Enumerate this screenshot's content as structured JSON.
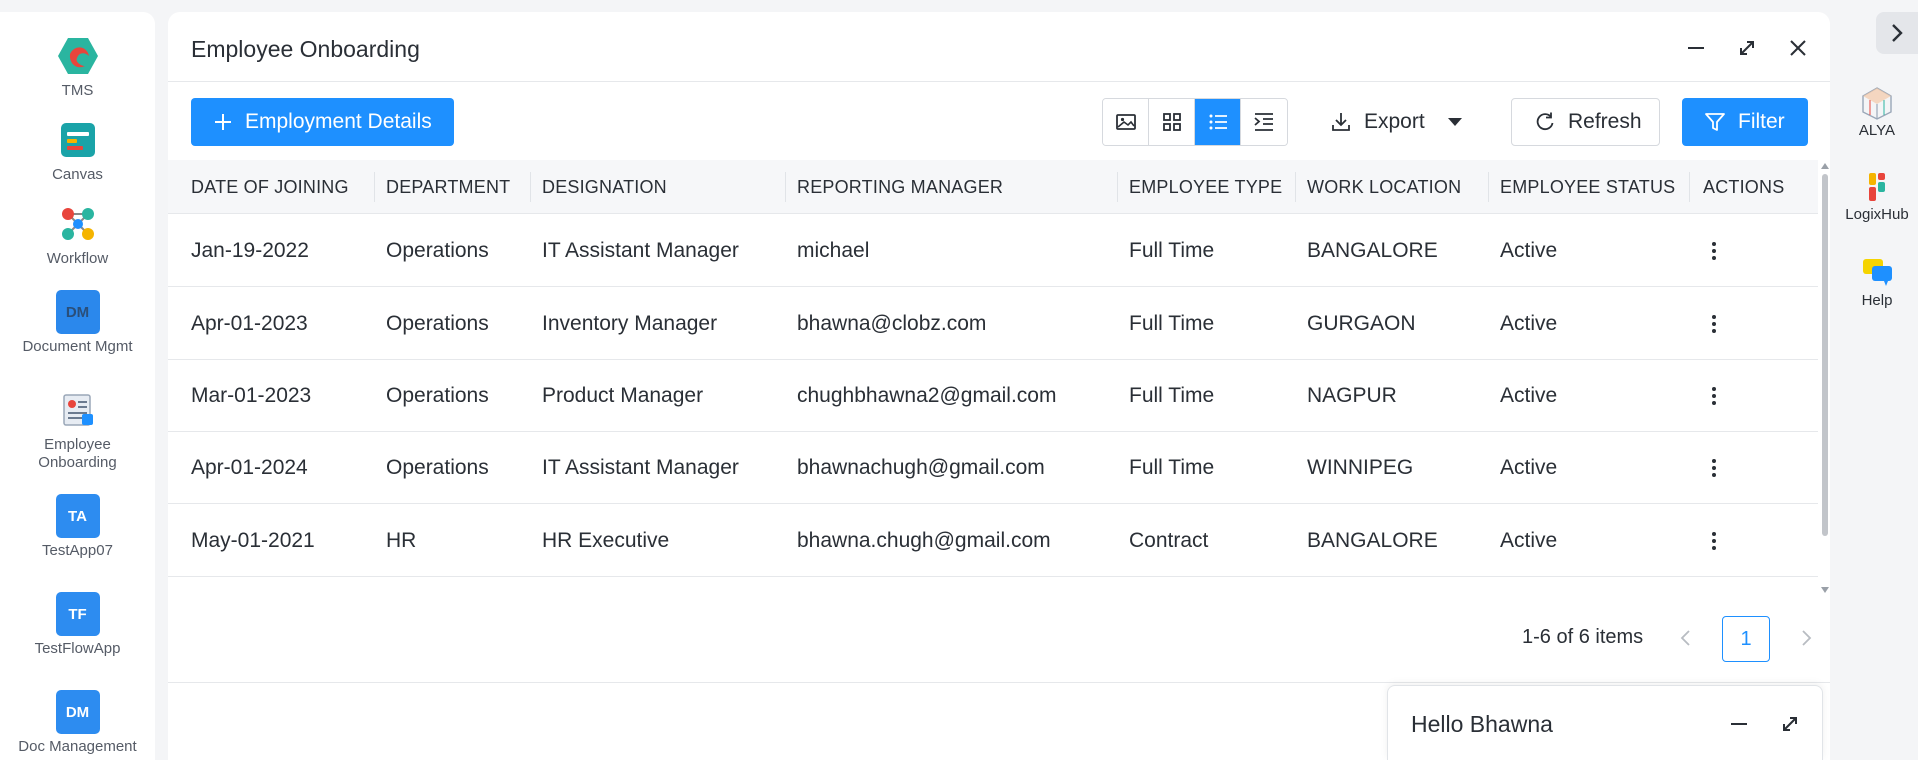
{
  "left_sidebar": {
    "apps": [
      {
        "label": "TMS",
        "icon": "tms-hexagon-icon"
      },
      {
        "label": "Canvas",
        "icon": "canvas-icon"
      },
      {
        "label": "Workflow",
        "icon": "workflow-icon"
      },
      {
        "label": "Document Mgmt",
        "icon": "document-mgmt-icon",
        "tile": "DM"
      },
      {
        "label": "Employee Onboarding",
        "icon": "employee-onboarding-icon"
      },
      {
        "label": "TestApp07",
        "icon": "testapp07-icon",
        "tile": "TA"
      },
      {
        "label": "TestFlowApp",
        "icon": "testflowapp-icon",
        "tile": "TF"
      },
      {
        "label": "Doc Management",
        "icon": "doc-management-icon",
        "tile": "DM"
      }
    ]
  },
  "window": {
    "title": "Employee Onboarding",
    "controls": [
      "minimize-icon",
      "expand-icon",
      "close-icon"
    ]
  },
  "toolbar": {
    "add_label": "Employment Details",
    "views": [
      "image-view-icon",
      "grid-view-icon",
      "list-view-icon",
      "indent-view-icon"
    ],
    "active_view": "list-view-icon",
    "export_label": "Export",
    "refresh_label": "Refresh",
    "filter_label": "Filter",
    "accent_color": "#1e90ff"
  },
  "table": {
    "columns": [
      "DATE OF JOINING",
      "DEPARTMENT",
      "DESIGNATION",
      "REPORTING MANAGER",
      "EMPLOYEE TYPE",
      "WORK LOCATION",
      "EMPLOYEE STATUS",
      "ACTIONS"
    ],
    "rows": [
      [
        "Jan-19-2022",
        "Operations",
        "IT Assistant Manager",
        "michael",
        "Full Time",
        "BANGALORE",
        "Active"
      ],
      [
        "Apr-01-2023",
        "Operations",
        "Inventory Manager",
        "bhawna@clobz.com",
        "Full Time",
        "GURGAON",
        "Active"
      ],
      [
        "Mar-01-2023",
        "Operations",
        "Product Manager",
        "chughbhawna2@gmail.com",
        "Full Time",
        "NAGPUR",
        "Active"
      ],
      [
        "Apr-01-2024",
        "Operations",
        "IT Assistant Manager",
        "bhawnachugh@gmail.com",
        "Full Time",
        "WINNIPEG",
        "Active"
      ],
      [
        "May-01-2021",
        "HR",
        "HR Executive",
        "bhawna.chugh@gmail.com",
        "Contract",
        "BANGALORE",
        "Active"
      ]
    ]
  },
  "pagination": {
    "summary": "1-6 of 6 items",
    "current_page": "1"
  },
  "chat": {
    "title": "Hello Bhawna"
  },
  "right_rail": {
    "items": [
      {
        "label": "ALYA",
        "icon": "alya-icon"
      },
      {
        "label": "LogixHub",
        "icon": "logixhub-icon"
      },
      {
        "label": "Help",
        "icon": "help-chat-icon"
      }
    ]
  }
}
